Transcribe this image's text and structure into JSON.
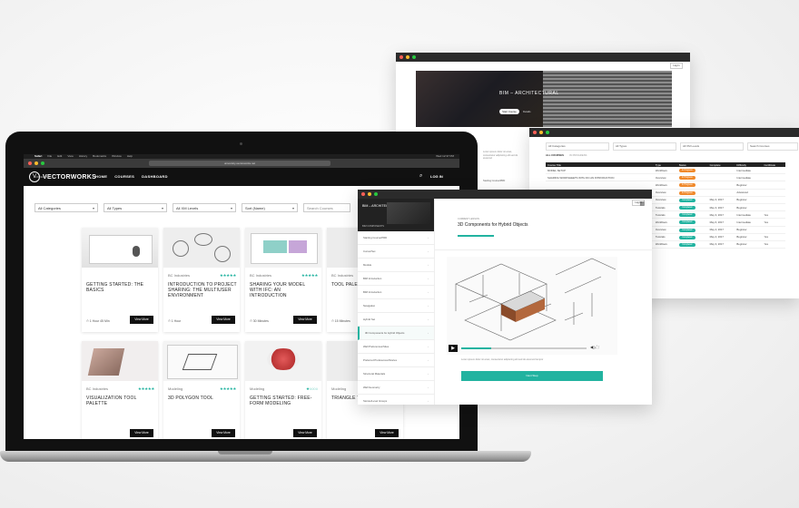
{
  "back_window": {
    "hero_title": "BIM – ARCHITECTURAL",
    "start_label": "Start Course",
    "more_label": "Details",
    "login_label": "Log In",
    "blurb": "Lorem ipsum dolor sit amet, consectetur adipiscing elit sed do eiusmod",
    "nav_item": "Starting Course/PRD"
  },
  "table_window": {
    "filters": [
      "All Categories",
      "All Types",
      "All XM Levels",
      "Search Courses"
    ],
    "tabs": [
      "ALL COURSES",
      "IN PROGRESS"
    ],
    "columns": [
      "Course Title",
      "Type",
      "Status",
      "Complete",
      "Difficulty",
      "Certificate"
    ],
    "rows": [
      [
        "MODEL SETUP",
        "Workflows",
        "In Progress",
        "",
        "Intermediate",
        ""
      ],
      [
        "SHARING WORKSHEETS WITH IFC AN INTRODUCTION",
        "Overview",
        "In Progress",
        "",
        "Intermediate",
        ""
      ],
      [
        "",
        "Workflows",
        "In Progress",
        "",
        "Beginner",
        ""
      ],
      [
        "",
        "Overview",
        "In Progress",
        "",
        "Advanced",
        ""
      ],
      [
        "",
        "Overview",
        "Completed",
        "May 3, 2017",
        "Beginner",
        ""
      ],
      [
        "",
        "Tutorials",
        "Completed",
        "May 3, 2017",
        "Beginner",
        ""
      ],
      [
        "",
        "Tutorials",
        "Completed",
        "May 3, 2017",
        "Intermediate",
        "Yes"
      ],
      [
        "",
        "Workflows",
        "Completed",
        "May 6, 2017",
        "Intermediate",
        "Yes"
      ],
      [
        "",
        "Overview",
        "Completed",
        "May 4, 2017",
        "Beginner",
        ""
      ],
      [
        "",
        "Tutorials",
        "Completed",
        "May 4, 2017",
        "Beginner",
        "Yes"
      ],
      [
        "",
        "Workflows",
        "Completed",
        "May 3, 2017",
        "Beginner",
        "Yes"
      ]
    ]
  },
  "laptop": {
    "menubar": [
      "Safari",
      "File",
      "Edit",
      "View",
      "History",
      "Bookmarks",
      "Window",
      "Help"
    ],
    "menubar_right": "Wed 12:37 PM",
    "url": "university.vectorworks.net",
    "brand": "VECTORWORKS",
    "brand_sub": "UNIVERSITY",
    "nav": [
      "HOME",
      "COURSES",
      "DASHBOARD"
    ],
    "login": "LOG IN",
    "filters": [
      "All Categories",
      "All Types",
      "All XM Levels",
      "Sort (Name)"
    ],
    "search_placeholder": "Search Courses",
    "cards": [
      {
        "category": "",
        "rating": "",
        "title": "GETTING STARTED: THE BASICS",
        "duration": "1 Hour 45 Min",
        "button": "View More"
      },
      {
        "category": "BC Industries",
        "rating": "★★★★★",
        "title": "INTRODUCTION TO PROJECT SHARING: THE MULTIUSER ENVIRONMENT",
        "duration": "1 Hour",
        "button": "View More"
      },
      {
        "category": "BC Industries",
        "rating": "★★★★★",
        "title": "SHARING YOUR MODEL WITH IFC: AN INTRODUCTION",
        "duration": "30 Minutes",
        "button": "View More"
      },
      {
        "category": "BC Industries",
        "rating": "",
        "title": "TOOL PALETTE",
        "duration": "15 Minutes",
        "button": "View More"
      },
      {
        "category": "BC Industries",
        "rating": "★★★★★",
        "title": "VISUALIZATION TOOL PALETTE",
        "duration": "",
        "button": "View More"
      },
      {
        "category": "Modeling",
        "rating": "★★★★★",
        "title": "3D POLYGON TOOL",
        "duration": "",
        "button": "View More"
      },
      {
        "category": "Modeling",
        "rating": "★○○○○",
        "title": "GETTING STARTED: FREE-FORM MODELING",
        "duration": "",
        "button": "View More"
      },
      {
        "category": "Modeling",
        "rating": "",
        "title": "TRIANGLE TOOL",
        "duration": "",
        "button": "View More"
      }
    ]
  },
  "lesson_window": {
    "side_title": "BIM – ARCHITECTURAL",
    "side_caption": "BIM COMPONENTS",
    "login_label": "Log In",
    "label": "CURRENT LESSON",
    "title": "3D Components for Hybrid Objects",
    "lessons": [
      "Starting Course/PRD",
      "Cursor/Set",
      "Module",
      "BIM Introduction",
      "BIM Introduction",
      "Navigation",
      "Hybrid Set",
      "3D Components for Hybrid Objects",
      "Wall Preferences/Sites",
      "Preferred Preferences/Stories",
      "Structural Materials",
      "Wall Geometry",
      "Stories/Level Groups"
    ],
    "note": "Lorem ipsum dolor sit amet, consectetur adipiscing elit sed do eiusmod tempor",
    "cta": "Next Step",
    "accent": "#22b3a0"
  }
}
